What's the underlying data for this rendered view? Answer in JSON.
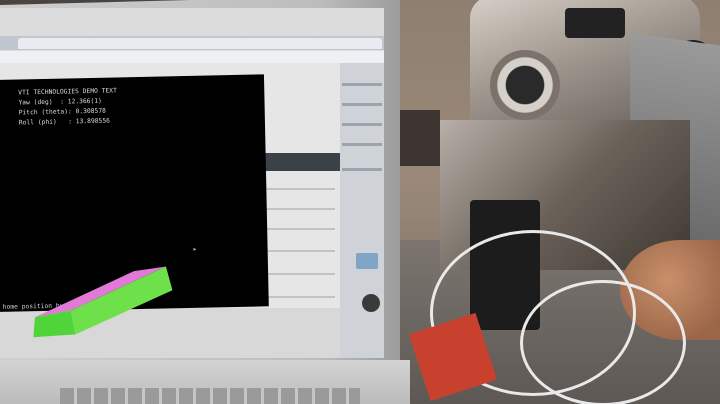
{
  "photo": {
    "subject": "laptop-and-rc-transmitter"
  },
  "browser": {
    "tabs": [
      "",
      "",
      "",
      "",
      ""
    ]
  },
  "terminal": {
    "lines": [
      "VTI TECHNOLOGIES DEMO TEXT",
      "Yaw (deg)  : 12.366(1)",
      "Pitch (theta): 0.308578",
      "Roll (phi)   : 13.898556"
    ],
    "footer": "home position by pressing 'a'"
  },
  "render": {
    "top_color": "#e07ad6",
    "side_color": "#6ee04a",
    "front_color": "#4fd43a"
  },
  "colors": {
    "laptop_bezel": "#c4c4c4",
    "terminal_bg": "#000000"
  }
}
